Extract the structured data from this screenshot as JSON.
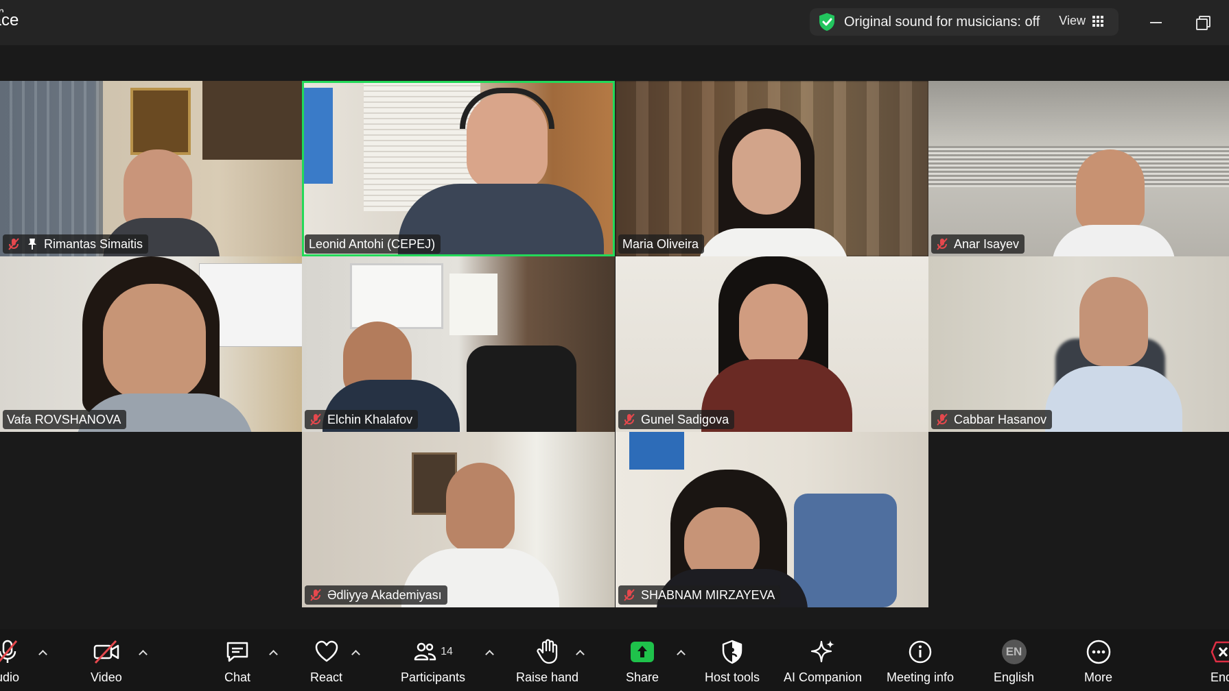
{
  "app": {
    "title_line1": "n",
    "title_line2": "kplace"
  },
  "header": {
    "sound_status": "Original sound for musicians: off",
    "view_label": "View"
  },
  "participants": [
    {
      "name": "Rimantas Simaitis",
      "muted": true,
      "pinned": true
    },
    {
      "name": "Leonid Antohi (CEPEJ)",
      "muted": false,
      "active_speaker": true
    },
    {
      "name": "Maria Oliveira",
      "muted": false
    },
    {
      "name": "Anar Isayev",
      "muted": true
    },
    {
      "name": "Vafa ROVSHANOVA",
      "muted": false
    },
    {
      "name": "Elchin Khalafov",
      "muted": true
    },
    {
      "name": "Gunel Sadigova",
      "muted": true
    },
    {
      "name": "Cabbar Hasanov",
      "muted": true
    },
    {
      "name": "Ədliyyə Akademiyası",
      "muted": true
    },
    {
      "name": "SHABNAM MIRZAYEVA",
      "muted": true
    }
  ],
  "toolbar": {
    "audio_label": "udio",
    "video_label": "Video",
    "chat_label": "Chat",
    "react_label": "React",
    "participants_label": "Participants",
    "participants_count": "14",
    "raise_hand_label": "Raise hand",
    "share_label": "Share",
    "host_tools_label": "Host tools",
    "ai_companion_label": "AI Companion",
    "meeting_info_label": "Meeting info",
    "language_label": "English",
    "language_badge": "EN",
    "more_label": "More",
    "end_label": "End"
  },
  "colors": {
    "active_speaker_border": "#23d959",
    "share_green": "#1fc24b",
    "mute_red": "#e5484d",
    "end_red": "#e02f44"
  }
}
